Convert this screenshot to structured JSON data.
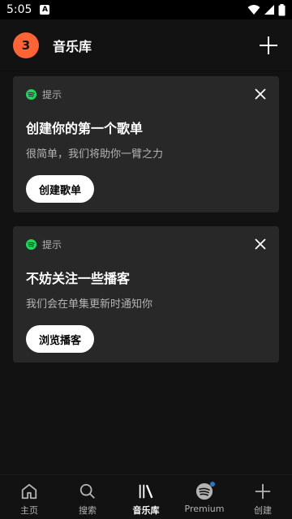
{
  "status_bar": {
    "time": "5:05"
  },
  "header": {
    "avatar_letter": "3",
    "title": "音乐库"
  },
  "cards": [
    {
      "tip": "提示",
      "title": "创建你的第一个歌单",
      "subtitle": "很简单，我们将助你一臂之力",
      "button": "创建歌单"
    },
    {
      "tip": "提示",
      "title": "不妨关注一些播客",
      "subtitle": "我们会在单集更新时通知你",
      "button": "浏览播客"
    }
  ],
  "nav": [
    {
      "label": "主页",
      "icon": "home-icon"
    },
    {
      "label": "搜索",
      "icon": "search-icon"
    },
    {
      "label": "音乐库",
      "icon": "library-icon"
    },
    {
      "label": "Premium",
      "icon": "spotify-icon"
    },
    {
      "label": "创建",
      "icon": "plus-icon"
    }
  ],
  "colors": {
    "accent": "#1ed760",
    "avatar": "#ff6437",
    "background": "#121212",
    "card": "#282828"
  }
}
